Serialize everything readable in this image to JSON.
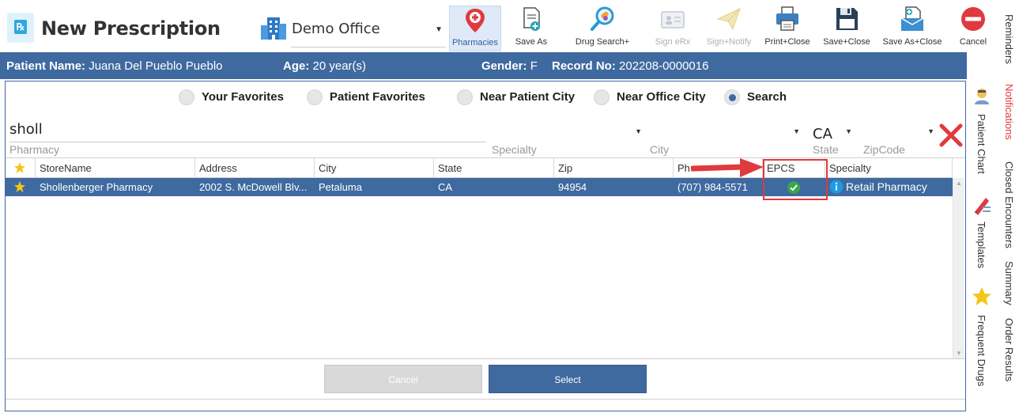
{
  "app": {
    "title": "New Prescription",
    "office": "Demo Office"
  },
  "toolbar": [
    {
      "label": "Pharmacies",
      "icon": "pharmacy-pin-icon",
      "active": true,
      "enabled": true
    },
    {
      "label": "Save As",
      "icon": "save-as-icon",
      "enabled": true
    },
    {
      "label": "Drug Search+",
      "icon": "drug-search-icon",
      "enabled": true
    },
    {
      "label": "Sign eRx",
      "icon": "sign-erx-icon",
      "enabled": false
    },
    {
      "label": "Sign+Notify",
      "icon": "paper-plane-icon",
      "enabled": false
    },
    {
      "label": "Print+Close",
      "icon": "printer-icon",
      "enabled": true
    },
    {
      "label": "Save+Close",
      "icon": "floppy-disk-icon",
      "enabled": true
    },
    {
      "label": "Save As+Close",
      "icon": "save-as-close-icon",
      "enabled": true
    },
    {
      "label": "Cancel",
      "icon": "cancel-icon",
      "enabled": true
    }
  ],
  "patient": {
    "name_label": "Patient Name:",
    "name": "Juana Del Pueblo Pueblo",
    "age_label": "Age:",
    "age": "20 year(s)",
    "gender_label": "Gender:",
    "gender": "F",
    "record_label": "Record No:",
    "record": "202208-0000016"
  },
  "search_modes": [
    {
      "label": "Your Favorites",
      "selected": false
    },
    {
      "label": "Patient Favorites",
      "selected": false
    },
    {
      "label": "Near Patient City",
      "selected": false
    },
    {
      "label": "Near Office City",
      "selected": false
    },
    {
      "label": "Search",
      "selected": true
    }
  ],
  "filters": {
    "pharmacy": {
      "value": "sholl",
      "label": "Pharmacy"
    },
    "specialty": {
      "value": "",
      "label": "Specialty"
    },
    "city": {
      "value": "",
      "label": "City"
    },
    "state": {
      "value": "CA",
      "label": "State"
    },
    "zip": {
      "value": "",
      "label": "ZipCode"
    }
  },
  "grid": {
    "columns": [
      "StoreName",
      "Address",
      "City",
      "State",
      "Zip",
      "Phone",
      "EPCS",
      "Specialty"
    ],
    "columns_display": [
      "StoreName",
      "Address",
      "City",
      "State",
      "Zip",
      "Ph",
      "EPCS",
      "Specialty"
    ],
    "rows": [
      {
        "favorite": true,
        "store": "Shollenberger Pharmacy",
        "address": "2002 S. McDowell Blv...",
        "city": "Petaluma",
        "state": "CA",
        "zip": "94954",
        "phone": "(707) 984-5571",
        "epcs": true,
        "specialty": "Retail Pharmacy"
      }
    ]
  },
  "buttons": {
    "cancel": "Cancel",
    "select": "Select"
  },
  "side_tabs": {
    "right": [
      "Reminders",
      "Notifications",
      "Closed Encounters",
      "Summary",
      "Order Results"
    ],
    "inner": [
      "Patient Chart",
      "Templates",
      "Frequent Drugs"
    ]
  },
  "colors": {
    "brand": "#3f6aa0",
    "alert": "#e0393e",
    "star": "#f5c518",
    "ok": "#3aa54a"
  }
}
